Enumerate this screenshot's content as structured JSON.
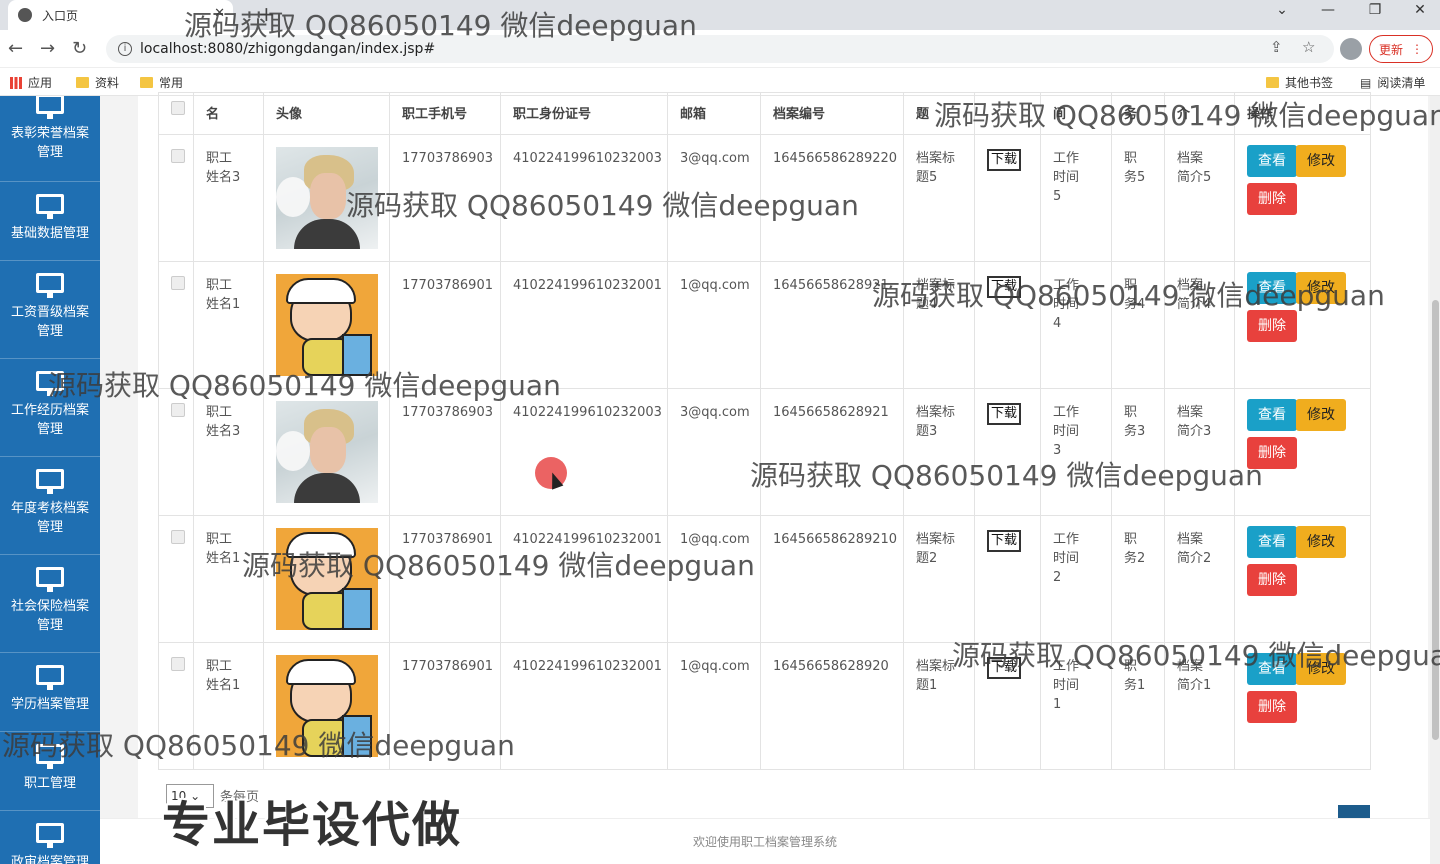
{
  "browser": {
    "tab_title": "入口页",
    "url": "localhost:8080/zhigongdangan/index.jsp#",
    "update_label": "更新",
    "bookmarks": [
      "应用",
      "资料",
      "常用"
    ],
    "other_bookmarks": "其他书签",
    "reading_list": "阅读清单"
  },
  "sidebar": {
    "items": [
      {
        "label": "表彰荣誉档案管理"
      },
      {
        "label": "基础数据管理"
      },
      {
        "label": "工资晋级档案管理"
      },
      {
        "label": "工作经历档案管理"
      },
      {
        "label": "年度考核档案管理"
      },
      {
        "label": "社会保险档案管理"
      },
      {
        "label": "学历档案管理"
      },
      {
        "label": "职工管理"
      },
      {
        "label": "政审档案管理"
      }
    ]
  },
  "table": {
    "headers": [
      "名",
      "头像",
      "职工手机号",
      "职工身份证号",
      "邮箱",
      "档案编号",
      "题",
      "",
      "间",
      "务",
      "介",
      "操作"
    ],
    "download_label": "下载",
    "view_label": "查看",
    "edit_label": "修改",
    "delete_label": "删除",
    "rows": [
      {
        "name": "职工姓名3",
        "avatar": "person",
        "phone": "17703786903",
        "idcard": "410224199610232003",
        "email": "3@qq.com",
        "archive_no": "164566586289220",
        "title": "档案标题5",
        "time": "工作时间5",
        "duty": "职务5",
        "intro": "档案简介5"
      },
      {
        "name": "职工姓名1",
        "avatar": "cartoon",
        "phone": "17703786901",
        "idcard": "410224199610232001",
        "email": "1@qq.com",
        "archive_no": "16456658628921",
        "title": "档案标题4",
        "time": "工作时间4",
        "duty": "职务4",
        "intro": "档案简介4"
      },
      {
        "name": "职工姓名3",
        "avatar": "person",
        "phone": "17703786903",
        "idcard": "410224199610232003",
        "email": "3@qq.com",
        "archive_no": "16456658628921",
        "title": "档案标题3",
        "time": "工作时间3",
        "duty": "职务3",
        "intro": "档案简介3"
      },
      {
        "name": "职工姓名1",
        "avatar": "cartoon",
        "phone": "17703786901",
        "idcard": "410224199610232001",
        "email": "1@qq.com",
        "archive_no": "164566586289210",
        "title": "档案标题2",
        "time": "工作时间2",
        "duty": "职务2",
        "intro": "档案简介2"
      },
      {
        "name": "职工姓名1",
        "avatar": "cartoon",
        "phone": "17703786901",
        "idcard": "410224199610232001",
        "email": "1@qq.com",
        "archive_no": "16456658628920",
        "title": "档案标题1",
        "time": "工作时间1",
        "duty": "职务1",
        "intro": "档案简介1"
      }
    ]
  },
  "pager": {
    "page_size": "10",
    "page_size_suffix": "条每页"
  },
  "footer_text": "欢迎使用职工档案管理系统",
  "promo_text": "专业毕设代做",
  "watermark": "源码获取 QQ86050149 微信deepguan",
  "colors": {
    "sidebar": "#1f6fb2",
    "view": "#1aa0c8",
    "edit": "#f0ad1e",
    "delete": "#e8413d"
  }
}
